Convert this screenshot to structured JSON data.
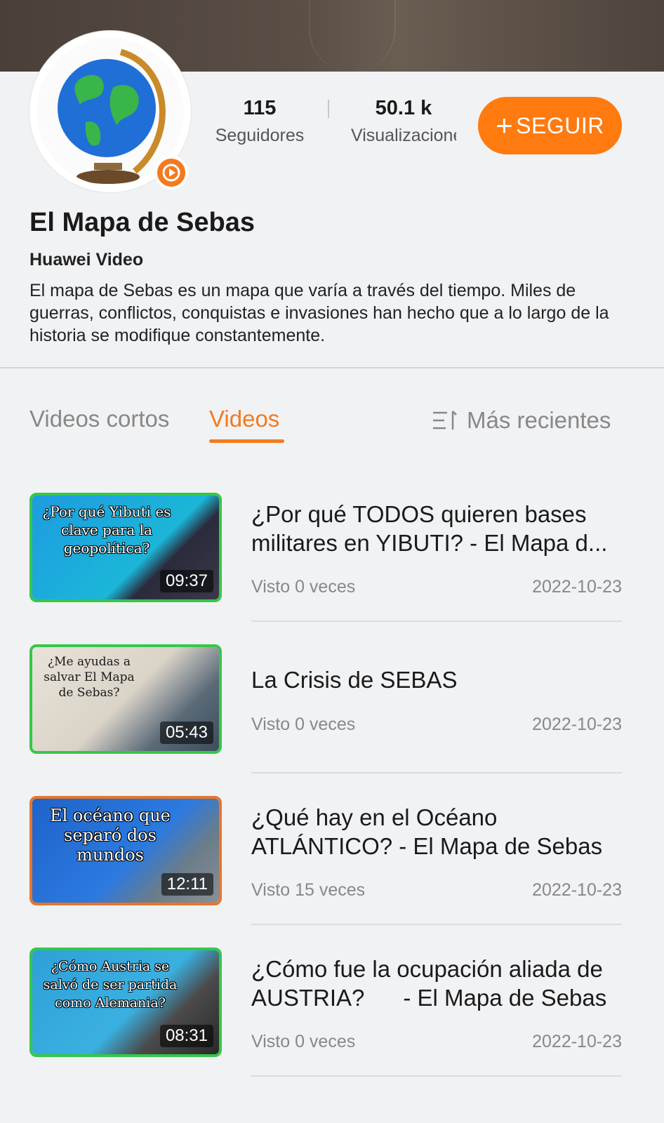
{
  "profile": {
    "followers_count": "115",
    "followers_label": "Seguidores",
    "views_count": "50.1 k",
    "views_label": "Visualizaciones",
    "follow_button": "SEGUIR",
    "channel_name": "El Mapa de Sebas",
    "platform": "Huawei Video",
    "description": "El mapa de Sebas es un mapa que varía a través del tiempo. Miles de guerras, conflictos, conquistas e invasiones han hecho que a lo largo de la historia se modifique constantemente.",
    "accent_color": "#f47a1f"
  },
  "tabs": [
    {
      "label": "Videos cortos",
      "active": false
    },
    {
      "label": "Videos",
      "active": true
    }
  ],
  "sort_label": "Más recientes",
  "videos": [
    {
      "thumb_text": "¿Por qué Yibuti es clave para la geopolítica?",
      "duration": "09:37",
      "title": "¿Por qué TODOS quieren bases militares en YIBUTI? - El Mapa d...",
      "views": "Visto 0 veces",
      "date": "2022-10-23"
    },
    {
      "thumb_text": "¿Me ayudas a salvar El Mapa de Sebas?",
      "duration": "05:43",
      "title": "La Crisis de SEBAS",
      "views": "Visto 0 veces",
      "date": "2022-10-23"
    },
    {
      "thumb_text": "El océano que separó dos mundos",
      "duration": "12:11",
      "title": "¿Qué hay en el Océano ATLÁNTICO?  - El Mapa de Sebas",
      "views": "Visto 15 veces",
      "date": "2022-10-23"
    },
    {
      "thumb_text": "¿Cómo Austria se salvó de ser partida como Alemania?",
      "duration": "08:31",
      "title": "¿Cómo fue la ocupación aliada de AUSTRIA?      - El Mapa de Sebas",
      "views": "Visto 0 veces",
      "date": "2022-10-23"
    }
  ]
}
